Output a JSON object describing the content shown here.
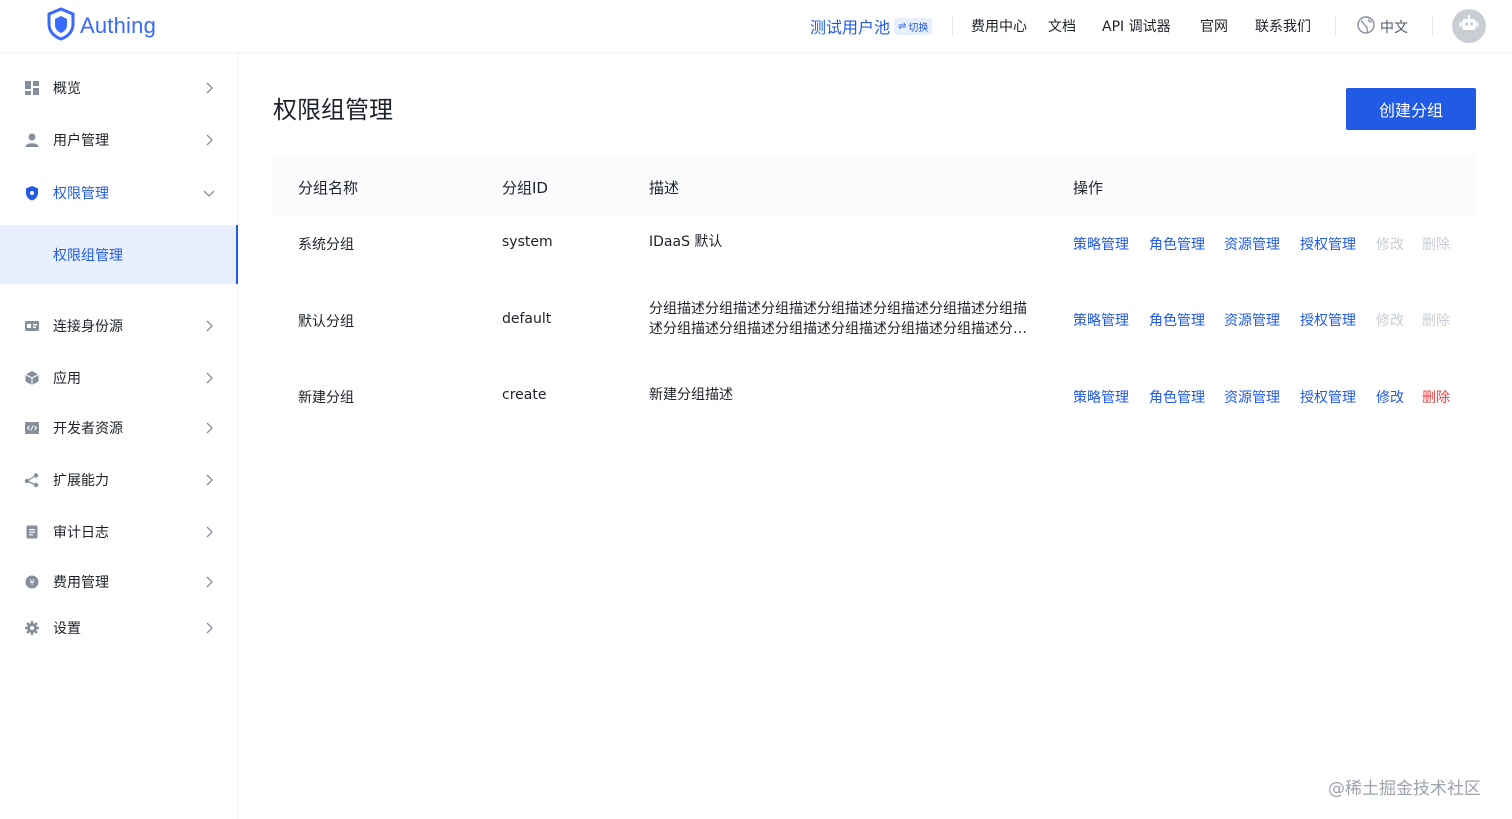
{
  "header": {
    "logo_text": "Authing",
    "pool_name": "测试用户池",
    "switch_label": "切换",
    "nav": [
      "费用中心",
      "文档",
      "API 调试器",
      "官网",
      "联系我们"
    ],
    "language": "中文"
  },
  "sidebar": {
    "items": [
      {
        "label": "概览",
        "icon": "dashboard-icon"
      },
      {
        "label": "用户管理",
        "icon": "user-icon"
      },
      {
        "label": "权限管理",
        "icon": "shield-icon"
      },
      {
        "label": "连接身份源",
        "icon": "id-card-icon"
      },
      {
        "label": "应用",
        "icon": "cube-icon"
      },
      {
        "label": "开发者资源",
        "icon": "code-icon"
      },
      {
        "label": "扩展能力",
        "icon": "share-icon"
      },
      {
        "label": "审计日志",
        "icon": "document-icon"
      },
      {
        "label": "费用管理",
        "icon": "coin-icon"
      },
      {
        "label": "设置",
        "icon": "gear-icon"
      }
    ],
    "sub_item": "权限组管理"
  },
  "main": {
    "title": "权限组管理",
    "create_button": "创建分组",
    "table": {
      "columns": [
        "分组名称",
        "分组ID",
        "描述",
        "操作"
      ],
      "rows": [
        {
          "name": "系统分组",
          "id": "system",
          "desc": "IDaaS 默认"
        },
        {
          "name": "默认分组",
          "id": "default",
          "desc": "分组描述分组描述分组描述分组描述分组描述分组描述分组描述分组描述分组描述分组描述分组描述分组描述分组描述分组描..."
        },
        {
          "name": "新建分组",
          "id": "create",
          "desc": "新建分组描述"
        }
      ],
      "actions": [
        "策略管理",
        "角色管理",
        "资源管理",
        "授权管理",
        "修改",
        "删除"
      ]
    }
  },
  "watermark": "@稀土掘金技术社区",
  "colors": {
    "primary": "#215ae5",
    "danger": "#f53f3f",
    "disabled": "#c9cdd4"
  }
}
